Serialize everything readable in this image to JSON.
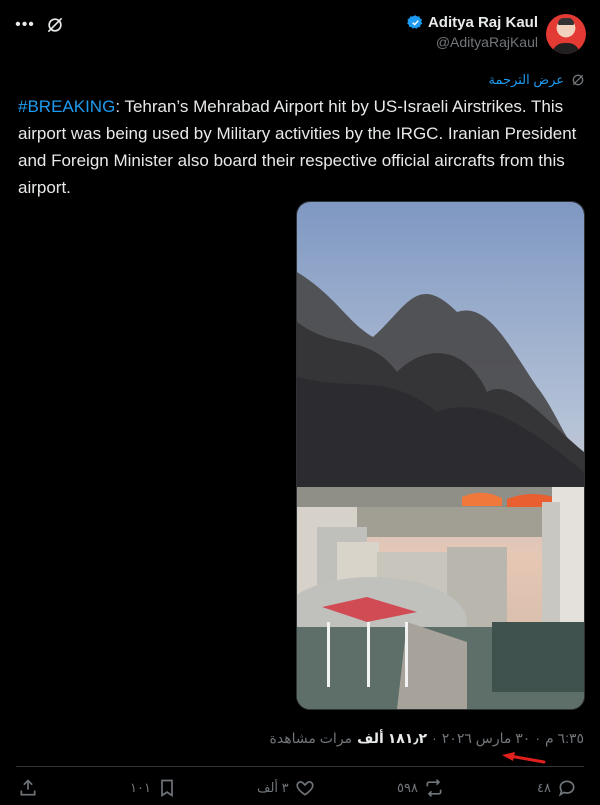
{
  "header": {
    "author_name": "Aditya Raj Kaul",
    "author_handle": "@AdityaRajKaul",
    "verified_color": "#1d9bf0"
  },
  "translate": {
    "label": "عرض الترجمة"
  },
  "tweet": {
    "hashtag": "#BREAKING",
    "body": ": Tehran’s Mehrabad Airport hit by US-Israeli Airstrikes. This airport was being used by Military activities by the IRGC. Iranian President and Foreign Minister also board their respective official aircrafts from this airport."
  },
  "meta": {
    "time": "٦:٣٥ م",
    "date": "٣٠ مارس ٢٠٢٦",
    "separator": "·",
    "views_count": "١٨١٫٢ ألف",
    "views_label": "مرات مشاهدة"
  },
  "actions": {
    "replies": "٤٨",
    "reposts": "٥٩٨",
    "likes": "٣ ألف",
    "bookmarks": "١٠١"
  },
  "colors": {
    "background": "#000000",
    "text": "#e7e9ea",
    "muted": "#71767b",
    "accent": "#1d9bf0",
    "arrow": "#e0201c"
  },
  "icons": [
    "more-icon",
    "grok-icon",
    "verified-icon",
    "translate-icon",
    "reply-icon",
    "repost-icon",
    "like-icon",
    "bookmark-icon",
    "share-icon"
  ]
}
